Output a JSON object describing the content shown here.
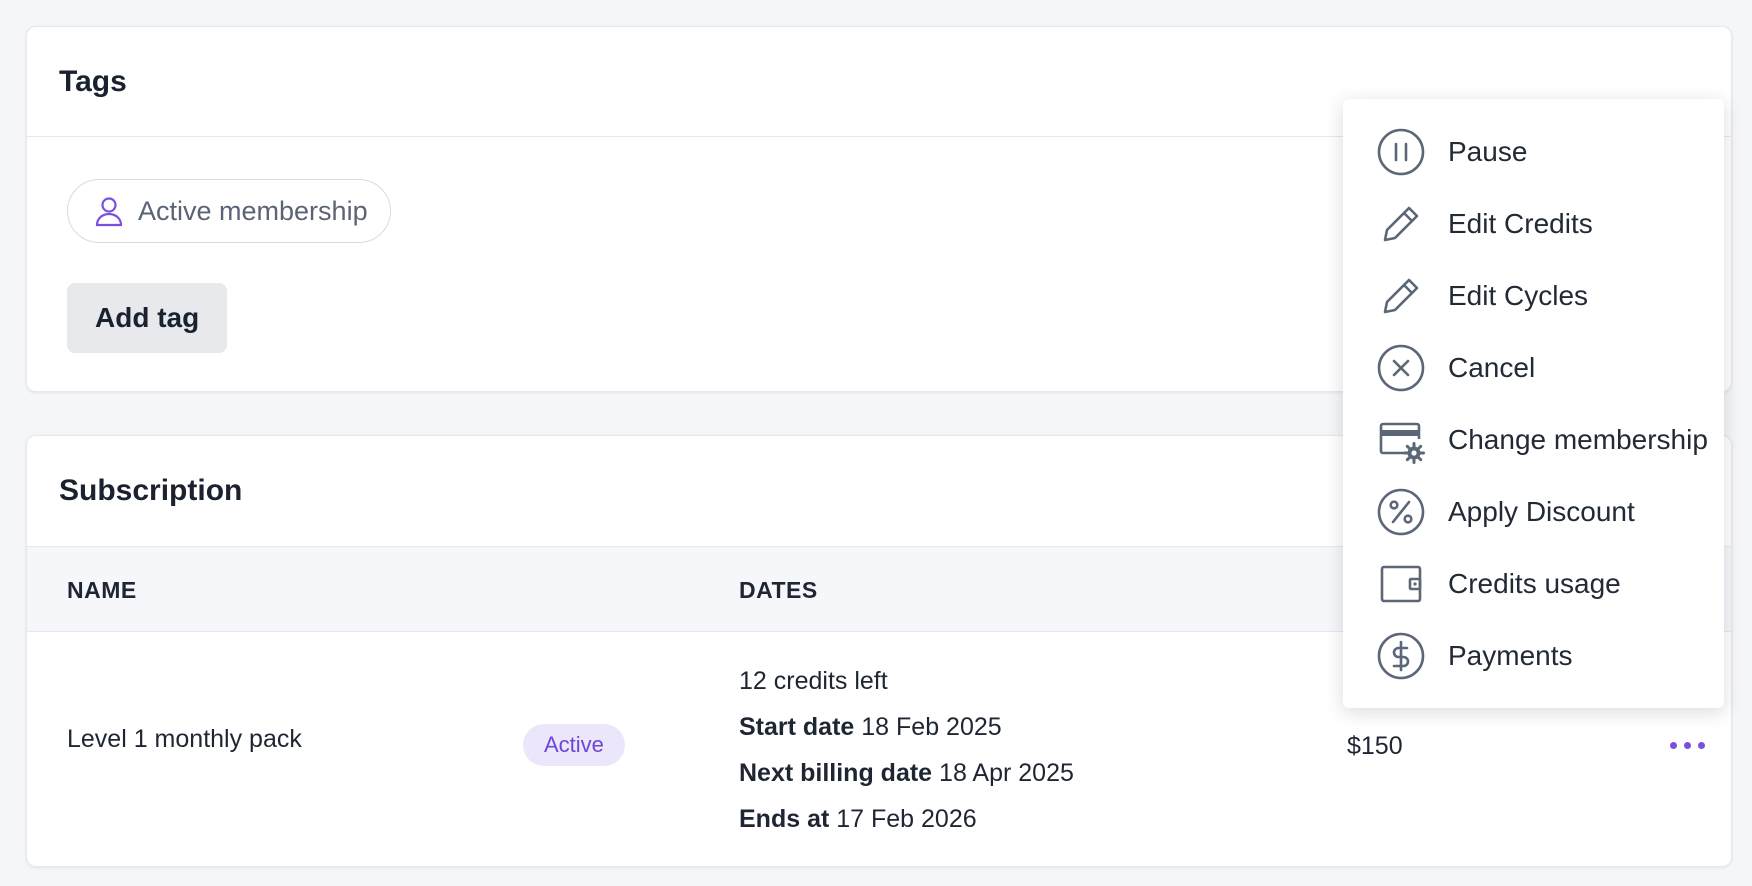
{
  "tags_card": {
    "title": "Tags",
    "tag": {
      "label": "Active membership",
      "icon": "user-icon"
    },
    "add_tag_label": "Add tag"
  },
  "subscription_card": {
    "title": "Subscription",
    "columns": {
      "name": "NAME",
      "dates": "DATES"
    },
    "row": {
      "name": "Level 1 monthly pack",
      "status": "Active",
      "credits_left": "12 credits left",
      "start_date_label": "Start date",
      "start_date": "18 Feb 2025",
      "next_billing_label": "Next billing date",
      "next_billing": "18 Apr 2025",
      "ends_label": "Ends at",
      "ends": "17 Feb 2026",
      "price": "$150"
    }
  },
  "menu": {
    "items": [
      {
        "label": "Pause",
        "icon": "pause-circle-icon"
      },
      {
        "label": "Edit Credits",
        "icon": "pencil-icon"
      },
      {
        "label": "Edit Cycles",
        "icon": "pencil-icon"
      },
      {
        "label": "Cancel",
        "icon": "x-circle-icon"
      },
      {
        "label": "Change membership",
        "icon": "card-settings-icon"
      },
      {
        "label": "Apply Discount",
        "icon": "percent-circle-icon"
      },
      {
        "label": "Credits usage",
        "icon": "wallet-icon"
      },
      {
        "label": "Payments",
        "icon": "dollar-circle-icon"
      }
    ]
  },
  "colors": {
    "accent": "#7b4fe0",
    "badge_bg": "#ece6fb",
    "badge_text": "#6f45d9",
    "icon_gray": "#5b6677"
  }
}
